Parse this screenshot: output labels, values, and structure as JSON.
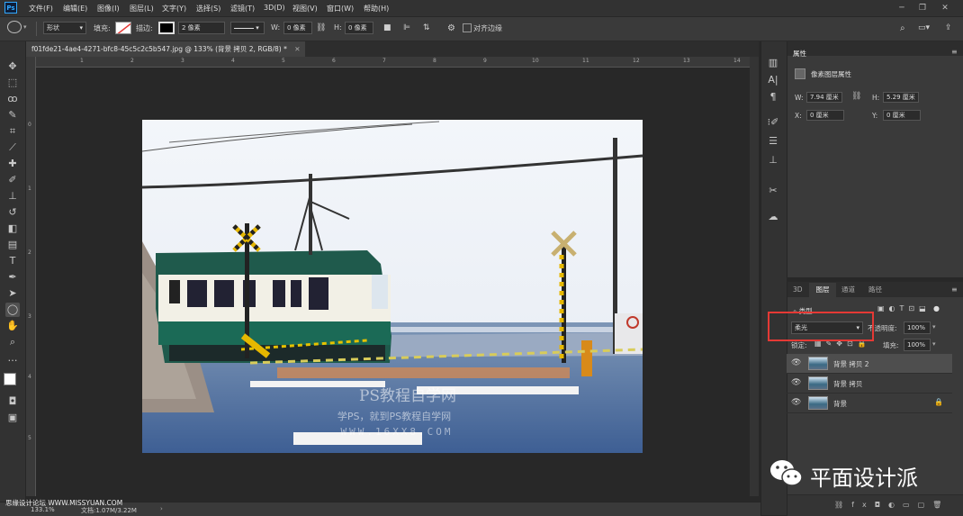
{
  "app": {
    "logo": "Ps"
  },
  "menu": [
    "文件(F)",
    "编辑(E)",
    "图像(I)",
    "图层(L)",
    "文字(Y)",
    "选择(S)",
    "滤镜(T)",
    "3D(D)",
    "视图(V)",
    "窗口(W)",
    "帮助(H)"
  ],
  "options": {
    "shape_mode": "形状",
    "fill_label": "填充:",
    "stroke_label": "描边:",
    "stroke_width": "2 像素",
    "w_label": "W:",
    "w_value": "0 像素",
    "h_label": "H:",
    "h_value": "0 像素",
    "align_edges": "对齐边缘"
  },
  "document": {
    "tab_title": "f01fde21-4ae4-4271-bfc8-45c5c2c5b547.jpg @ 133% (背景 拷贝 2, RGB/8) *",
    "ruler_h": [
      "1",
      "2",
      "3",
      "4",
      "5",
      "6",
      "7",
      "8",
      "9",
      "10",
      "11",
      "12",
      "13",
      "14"
    ],
    "ruler_v": [
      "0",
      "1",
      "2",
      "3",
      "4",
      "5"
    ]
  },
  "photo_overlay": {
    "line1": "PS教程自学网",
    "line2": "学PS，就到PS教程自学网",
    "line3": "WWW.16XX8.COM"
  },
  "status": {
    "zoom": "133.1%",
    "doc_info": "文档:1.07M/3.22M",
    "corner_watermark": "思缘设计论坛 WWW.MISSYUAN.COM"
  },
  "properties": {
    "title": "属性",
    "subtitle": "像素图层属性",
    "w_label": "W:",
    "w_value": "7.94 厘米",
    "h_label": "H:",
    "h_value": "5.29 厘米",
    "x_label": "X:",
    "x_value": "0 厘米",
    "y_label": "Y:",
    "y_value": "0 厘米"
  },
  "layers_panel": {
    "tabs": [
      "3D",
      "图层",
      "通道",
      "路径"
    ],
    "active_tab": "图层",
    "filter_label": "类型",
    "blend_mode": "柔光",
    "opacity_label": "不透明度:",
    "opacity_value": "100%",
    "lock_label": "锁定:",
    "fill_label": "填充:",
    "fill_value": "100%",
    "layers": [
      {
        "name": "背景 拷贝 2",
        "selected": true
      },
      {
        "name": "背景 拷贝",
        "selected": false
      },
      {
        "name": "背景",
        "selected": false,
        "locked": true
      }
    ]
  },
  "watermark": {
    "text": "平面设计派"
  },
  "colors": {
    "accent_red": "#e53935",
    "ps_blue": "#31a8ff"
  }
}
